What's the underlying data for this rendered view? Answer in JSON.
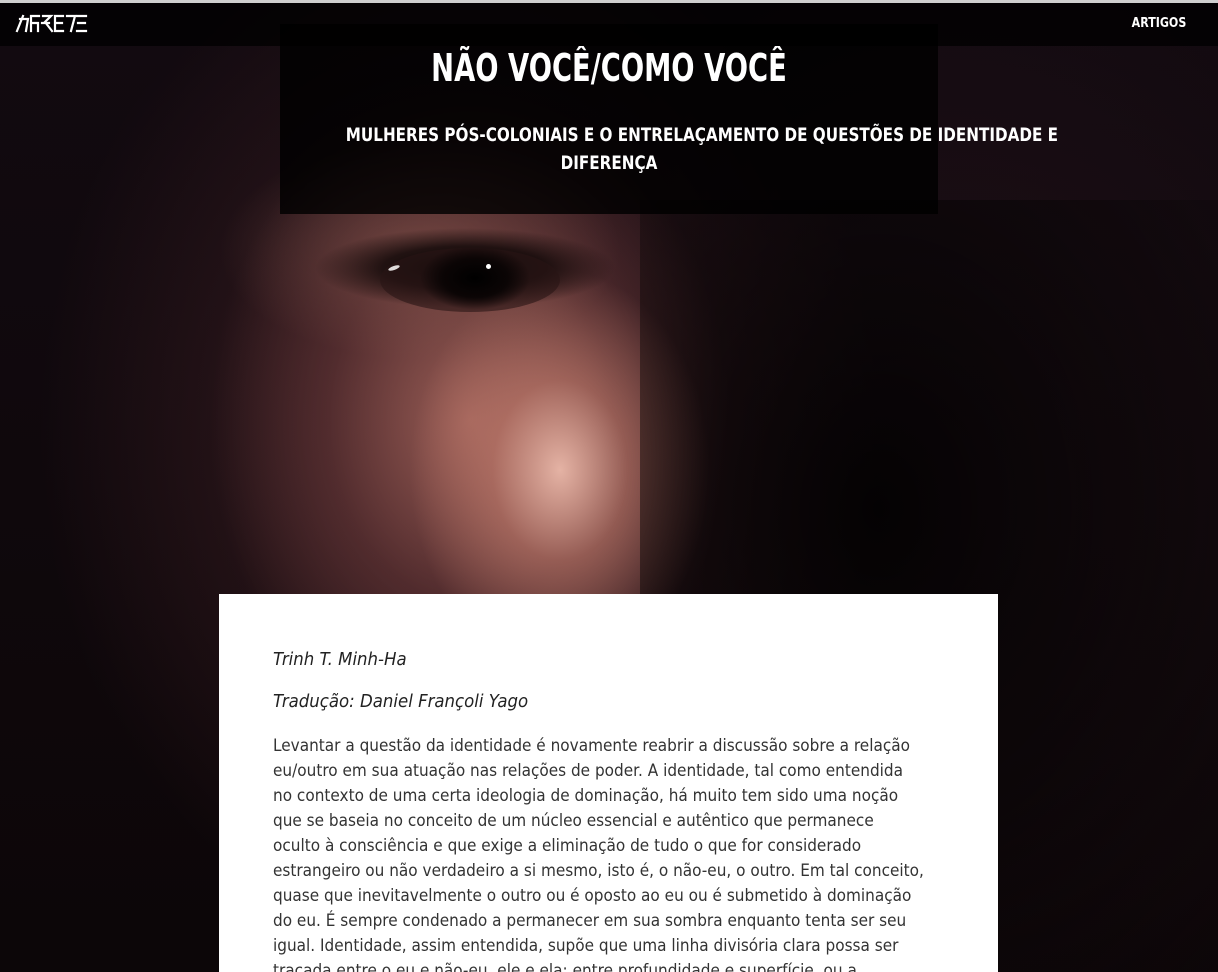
{
  "nav": {
    "logo_text": "AGRESTE",
    "link_label": "ARTIGOS"
  },
  "hero": {
    "title": "NÃO VOCÊ/COMO VOCÊ",
    "subtitle_line1": "MULHERES PÓS-COLONIAIS E O ENTRELAÇAMENTO DE QUESTÕES DE IDENTIDADE E",
    "subtitle_line2": "DIFERENÇA"
  },
  "article": {
    "author": "Trinh T. Minh-Ha",
    "translator": "Tradução: Daniel Françoli Yago",
    "body_lines": [
      "Levantar a questão da identidade é novamente reabrir a discussão sobre a relação",
      "eu/outro em sua atuação nas relações de poder. A identidade, tal como entendida",
      "no contexto de uma certa ideologia de dominação, há muito tem sido uma noção",
      "que se baseia no conceito de um núcleo essencial e autêntico que permanece",
      "oculto à consciência e que exige a eliminação de tudo o que for considerado",
      "estrangeiro ou não verdadeiro a si mesmo, isto é, o não-eu, o outro. Em tal conceito,",
      "quase que inevitavelmente o outro ou é oposto ao eu ou é submetido à dominação",
      "do eu. É sempre condenado a permanecer em sua sombra enquanto tenta ser seu",
      "igual. Identidade, assim entendida, supõe que uma linha divisória clara possa ser",
      "traçada entre o eu e não-eu, ele e ela; entre profundidade e superfície, ou a"
    ]
  },
  "colors": {
    "card_background": "#ffffff",
    "overlay": "#000000",
    "text_light": "#ffffff",
    "text_dark": "#333333"
  }
}
